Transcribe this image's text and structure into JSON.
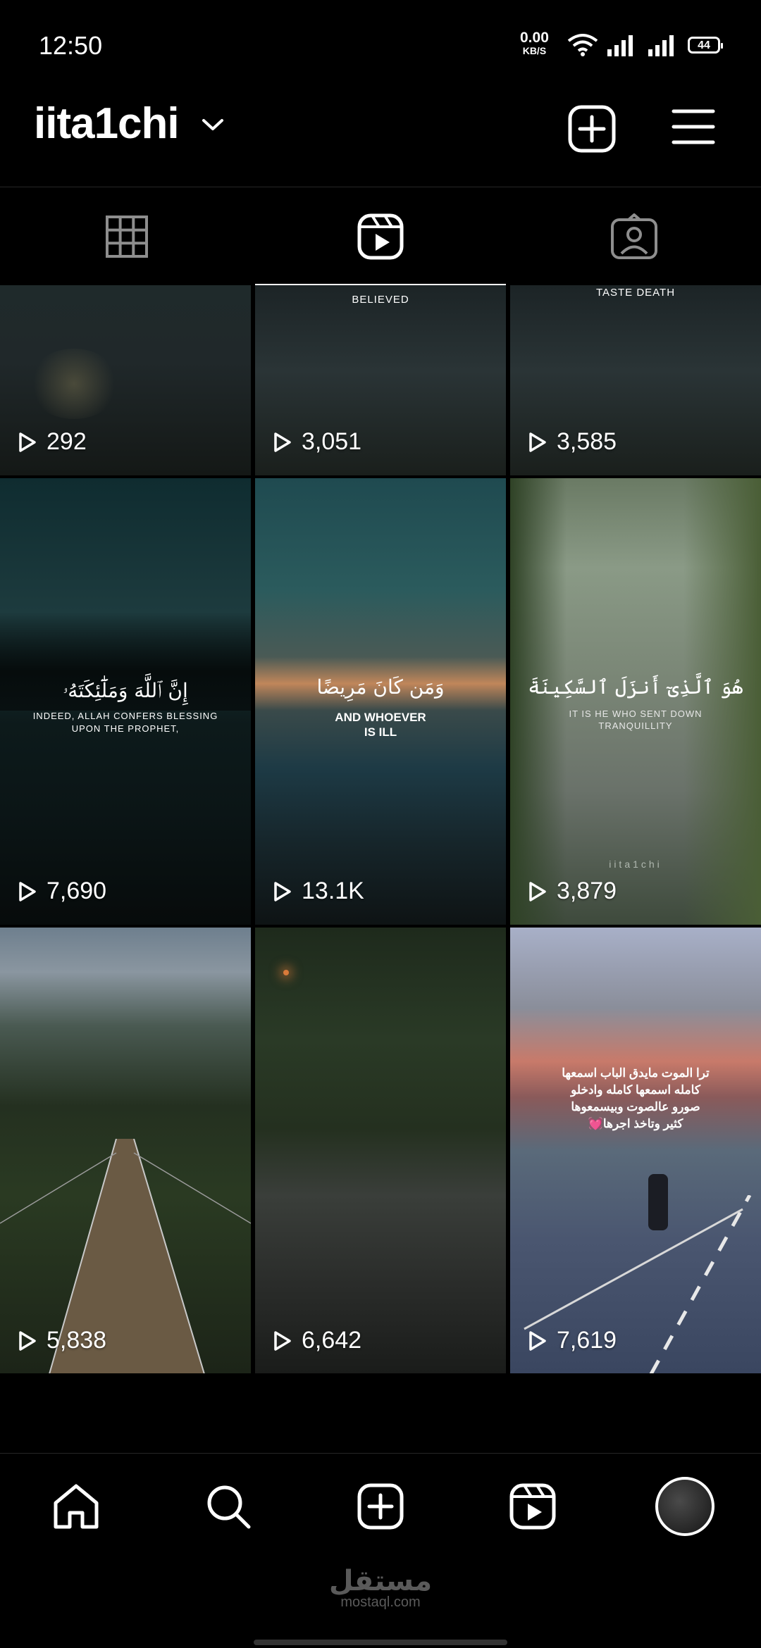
{
  "status": {
    "time": "12:50",
    "net_speed": "0.00",
    "net_unit": "KB/S",
    "battery": "44"
  },
  "header": {
    "username": "iita1chi"
  },
  "tabs": [
    {
      "name": "posts-grid",
      "icon": "grid-icon",
      "active": false
    },
    {
      "name": "reels",
      "icon": "reels-icon",
      "active": true
    },
    {
      "name": "tagged",
      "icon": "tagged-person-icon",
      "active": false
    }
  ],
  "reels": [
    {
      "views": "292",
      "overlay": ""
    },
    {
      "views": "3,051",
      "overlay": "BELIEVED"
    },
    {
      "views": "3,585",
      "overlay": "TASTE DEATH"
    },
    {
      "views": "7,690",
      "overlay_ar": "إِنَّ ٱللَّهَ وَمَلَٰٓئِكَتَهُۥ",
      "overlay_en1": "INDEED, ALLAH CONFERS BLESSING",
      "overlay_en2": "UPON THE PROPHET,"
    },
    {
      "views": "13.1K",
      "overlay_ar": "وَمَن كَانَ مَرِيضًا",
      "overlay_en1": "AND WHOEVER",
      "overlay_en2": "IS ILL"
    },
    {
      "views": "3,879",
      "overlay_ar": "هُوَ ٱلَّذِىٓ أَنزَلَ ٱلسَّكِينَةَ",
      "overlay_en1": "IT IS HE WHO SENT DOWN",
      "overlay_en2": "TRANQUILLITY",
      "watermark": "iita1chi"
    },
    {
      "views": "5,838"
    },
    {
      "views": "6,642"
    },
    {
      "views": "7,619",
      "overlay_lines": [
        "ترا الموت مايدق الباب اسمعها",
        "كامله اسمعها كامله وادخلو",
        "صورو عالصوت وبيسمعوها",
        "كثير وتاخذ اجرها💓"
      ]
    }
  ],
  "nav": [
    {
      "name": "home",
      "icon": "home-icon"
    },
    {
      "name": "search",
      "icon": "search-icon"
    },
    {
      "name": "create",
      "icon": "plus-square-icon"
    },
    {
      "name": "reels",
      "icon": "reels-icon"
    },
    {
      "name": "profile",
      "icon": "avatar"
    }
  ],
  "watermark": {
    "arabic": "مستقل",
    "latin": "mostaql.com"
  },
  "colors": {
    "background": "#000000",
    "divider": "#262626",
    "text": "#ffffff",
    "inactive_icon": "#8e8e8e"
  }
}
